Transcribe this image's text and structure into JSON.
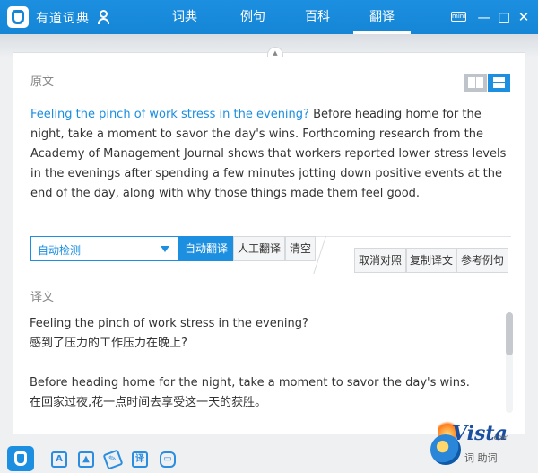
{
  "app": {
    "title": "有道词典"
  },
  "nav": {
    "tabs": [
      {
        "label": "词典",
        "active": false
      },
      {
        "label": "例句",
        "active": false
      },
      {
        "label": "百科",
        "active": false
      },
      {
        "label": "翻译",
        "active": true
      }
    ]
  },
  "window_controls": {
    "mini_label": "mini",
    "minimize": "—",
    "restore": "□",
    "close": "✕"
  },
  "source": {
    "label": "原文",
    "highlight": "Feeling the pinch of work stress in the evening?",
    "rest": " Before heading home for the night, take a moment to savor the day's wins. Forthcoming research from the Academy of Management Journal shows that workers reported lower stress levels in the evenings after spending a few minutes jotting down positive events at the end of the day, along with why those things made them feel good."
  },
  "toolbar": {
    "language_select": "自动检测",
    "auto_translate": "自动翻译",
    "human_translate": "人工翻译",
    "clear": "清空",
    "cancel_compare": "取消对照",
    "copy_translation": "复制译文",
    "reference_examples": "参考例句"
  },
  "translation": {
    "label": "译文",
    "pairs": [
      {
        "en": "Feeling the pinch of work stress in the evening?",
        "zh": "感到了压力的工作压力在晚上?"
      },
      {
        "en": "Before heading home for the night, take a moment to savor the day's wins.",
        "zh": "在回家过夜,花一点时间去享受这一天的获胜。"
      }
    ]
  },
  "bottom_icons": [
    "text-translate-icon",
    "image-translate-icon",
    "paint-icon",
    "translate-icon",
    "chat-icon"
  ],
  "watermark": {
    "text": "Vista",
    "domain": ".com",
    "subtitle": "词    助词"
  },
  "colors": {
    "accent": "#1d8fe0",
    "highlight_text": "#1a8ee0"
  }
}
